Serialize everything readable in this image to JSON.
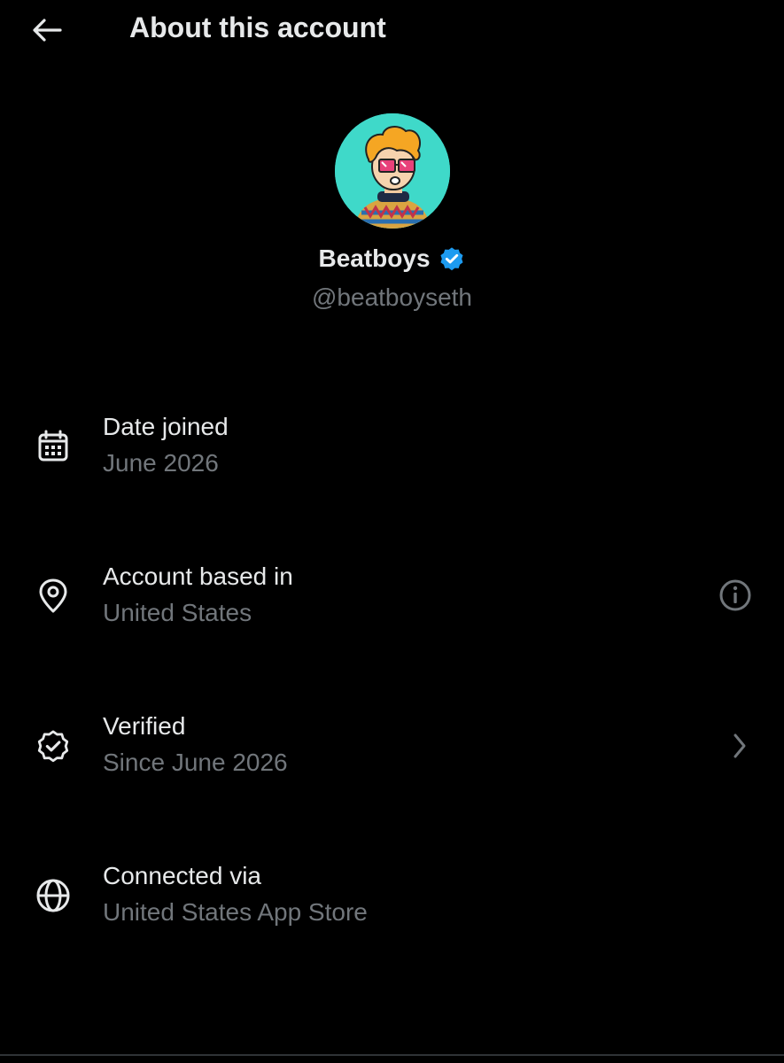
{
  "header": {
    "back_icon": "back-arrow-icon",
    "title": "About this account"
  },
  "profile": {
    "display_name": "Beatboys",
    "verified_icon": "verified-badge-icon",
    "handle": "@beatboyseth",
    "avatar_bg": "#3fd9c9"
  },
  "details": [
    {
      "icon": "calendar-icon",
      "title": "Date joined",
      "value": "June 2026"
    },
    {
      "icon": "location-pin-icon",
      "title": "Account based in",
      "value": "United States",
      "action_icon": "info-icon"
    },
    {
      "icon": "verified-check-icon",
      "title": "Verified",
      "value": "Since June 2026",
      "action_icon": "chevron-right-icon"
    },
    {
      "icon": "globe-icon",
      "title": "Connected via",
      "value": "United States App Store"
    }
  ],
  "colors": {
    "background": "#000000",
    "primary_text": "#e7e9ea",
    "secondary_text": "#71767b",
    "verified_blue": "#1d9bf0"
  }
}
